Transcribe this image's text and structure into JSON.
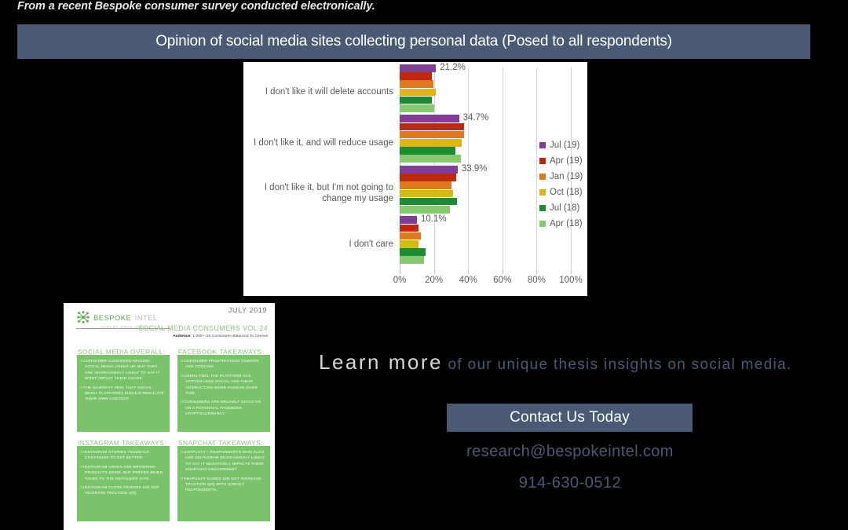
{
  "caption": "From a recent Bespoke consumer survey conducted electronically.",
  "title": "Opinion of social media sites collecting personal data (Posed to all respondents)",
  "colors": {
    "banner": "#4a5a75",
    "accent_green": "#7ac36a",
    "text_blue": "#4a5a75"
  },
  "chart_data": {
    "type": "bar",
    "orientation": "horizontal",
    "title": "Opinion of social media sites collecting personal data (Posed to all respondents)",
    "xlabel": "",
    "ylabel": "",
    "xlim": [
      0,
      100
    ],
    "xticks": [
      "0%",
      "20%",
      "40%",
      "60%",
      "80%",
      "100%"
    ],
    "xtick_values": [
      0,
      20,
      40,
      60,
      80,
      100
    ],
    "grid": true,
    "legend_position": "right",
    "categories": [
      "I don't like it will delete accounts",
      "I don't like it, and will reduce usage",
      "I don't like it, but I'm not going to change my usage",
      "I don't care"
    ],
    "series": [
      {
        "name": "Jul (19)",
        "color": "#7f3f98",
        "values": [
          21.2,
          34.7,
          33.9,
          10.1
        ]
      },
      {
        "name": "Apr (19)",
        "color": "#c0270f",
        "values": [
          19.0,
          37.5,
          33.0,
          11.2
        ]
      },
      {
        "name": "Jan (19)",
        "color": "#e07820",
        "values": [
          19.8,
          37.4,
          30.5,
          12.6
        ]
      },
      {
        "name": "Oct (18)",
        "color": "#ddb518",
        "values": [
          21.3,
          36.4,
          31.2,
          11.0
        ]
      },
      {
        "name": "Jul (18)",
        "color": "#1e8a32",
        "values": [
          19.0,
          32.6,
          33.4,
          15.2
        ]
      },
      {
        "name": "Apr (18)",
        "color": "#87c96f",
        "values": [
          20.3,
          35.6,
          29.4,
          14.0
        ]
      }
    ],
    "data_labels": [
      "21.2%",
      "34.7%",
      "33.9%",
      "10.1%"
    ],
    "data_label_series": "Jul (19)"
  },
  "report_card": {
    "logo_primary": "BESPOKE",
    "logo_secondary": "INTEL",
    "logo_sub": "SURVEY RESEARCH",
    "date": "JULY 2019",
    "volume": "SOCIAL MEDIA CONSUMERS VOL 24",
    "audience_label": "Audience:",
    "audience_text": "1,000+ US Consumers Balanced To Census",
    "sections": [
      {
        "heading": "SOCIAL MEDIA OVERALL:",
        "bullets": [
          "CONSUMER CONCERNS AROUND SOCIAL MEDIA CREEP UP, BUT THEY ARE INCREASINGLY LIKELY TO SAY IT WONT IMPACT THEIR USAGE.",
          "THE MAJORITY FEEL THAT SOCIAL MEDIA PLATFORMS SHOULD REGULATE THEIR OWN CONTENT."
        ]
      },
      {
        "heading": "FACEBOOK TAKEAWAYS:",
        "bullets": [
          "CONSUMER FRUSTRATIONS TOWARD ADS COOLING.",
          "USERS FEEL THE PLATFORM HAS GOTTEN LESS SOCIAL AND THEIR INTERACTION MORE PASSIVE OVER TIME.",
          "CONSUMERS ARE BROADLY NEGATIVE ON A POTENTIAL FACEBOOK CRYPTOCURRENCY."
        ]
      },
      {
        "heading": "INSTAGRAM TAKEAWAYS:",
        "bullets": [
          "INSTAGRAM STORIES FEEDBACK CONTINUES TO GET BETTER.",
          "INSTAGRAM USERS ARE BROWSING PRODUCTS MORE, BUT PREFER BEING TAKEN TO THE RETAILERS' SITE.",
          "INSTAGRAM CLOSE FRIENDS DID NOT INCREASE TRACTION Q/Q."
        ]
      },
      {
        "heading": "SNAPCHAT TAKEAWAYS:",
        "bullets": [
          "SNAPCHAT – RESPONDENTS WHO ALSO USE INSTAGRAM INCREASINGLY LIKELY TO SAY IT NEGATIVELY IMPACTS THEIR SNAPCHAT ENGAGEMENT.",
          "SNAPCHAT GAMES DID NOT INCREASE TRACTION Q/Q WITH SURVEY RESPONDENTS."
        ]
      }
    ]
  },
  "cta": {
    "learn_strong": "Learn more",
    "learn_rest": " of our unique thesis insights on social media.",
    "button_label": "Contact Us Today",
    "email": "research@bespokeintel.com",
    "phone": "914-630-0512"
  }
}
